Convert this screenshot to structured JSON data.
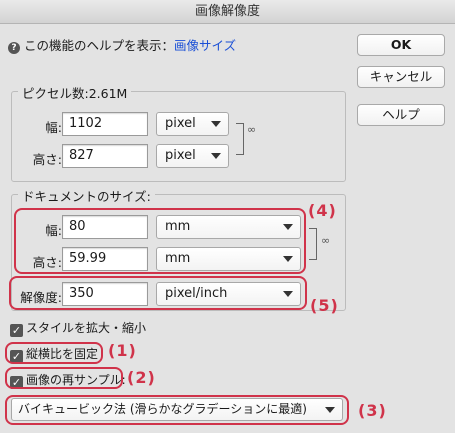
{
  "window": {
    "title": "画像解像度"
  },
  "help": {
    "prefix": "この機能のヘルプを表示：",
    "link": "画像サイズ"
  },
  "buttons": {
    "ok": "OK",
    "cancel": "キャンセル",
    "help": "ヘルプ"
  },
  "pixel_dimensions": {
    "legend": "ピクセル数:2.61M",
    "width_label": "幅:",
    "width_value": "1102",
    "width_unit": "pixel",
    "height_label": "高さ:",
    "height_value": "827",
    "height_unit": "pixel"
  },
  "document_size": {
    "legend": "ドキュメントのサイズ:",
    "width_label": "幅:",
    "width_value": "80",
    "width_unit": "mm",
    "height_label": "高さ:",
    "height_value": "59.99",
    "height_unit": "mm",
    "resolution_label": "解像度:",
    "resolution_value": "350",
    "resolution_unit": "pixel/inch"
  },
  "options": {
    "scale_styles": {
      "label": "スタイルを拡大・縮小",
      "checked": true
    },
    "constrain_proportions": {
      "label": "縦横比を固定",
      "checked": true
    },
    "resample": {
      "label": "画像の再サンプル:",
      "checked": true
    },
    "resample_method": "バイキュービック法 (滑らかなグラデーションに最適)"
  },
  "annotations": {
    "a1": "(1)",
    "a2": "(2)",
    "a3": "(3)",
    "a4": "(4)",
    "a5": "(5)",
    "color": "#d0334a"
  }
}
